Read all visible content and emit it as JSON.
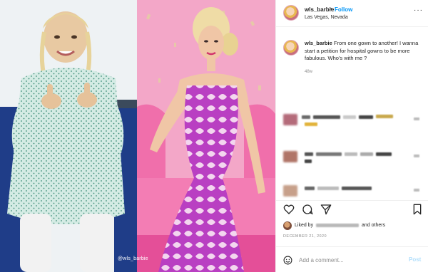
{
  "post": {
    "username": "wls_barbie",
    "follow_label": "Follow",
    "dot": "•",
    "location": "Las Vegas, Nevada",
    "more_glyph": "···",
    "caption_username": "wls_barbie",
    "caption_text": "From one gown to another! I wanna start a petition for hospital gowns to be more fabulous. Who's with me ?",
    "caption_time": "48w",
    "liked_by_prefix": "Liked by",
    "liked_by_suffix": "and others",
    "date": "DECEMBER 21, 2020",
    "comment_placeholder": "Add a comment...",
    "post_label": "Post",
    "watermark": "@wls_barbie"
  },
  "icons": {
    "heart": "heart-icon",
    "comment": "comment-icon",
    "share": "share-icon",
    "save": "bookmark-icon",
    "emoji": "emoji-icon"
  },
  "colors": {
    "accent": "#0095f6",
    "post_disabled": "#b2dffc",
    "pink_background": "#f29ac0",
    "gown_purple": "#c23fc9",
    "hospital_gown": "#cfe6df"
  }
}
